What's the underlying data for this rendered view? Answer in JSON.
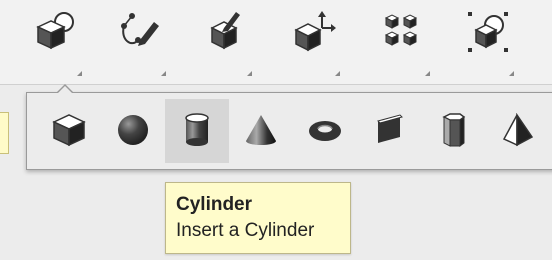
{
  "toolbar": {
    "tools": [
      {
        "name": "insert-shapes-tool",
        "icon": "cube-sphere-icon"
      },
      {
        "name": "paint-tool",
        "icon": "curve-pen-icon"
      },
      {
        "name": "edit-tool",
        "icon": "cube-pen-icon"
      },
      {
        "name": "transform-tool",
        "icon": "cube-axes-icon"
      },
      {
        "name": "group-tool",
        "icon": "cube-grid-icon"
      },
      {
        "name": "selection-tool",
        "icon": "cube-select-icon"
      }
    ]
  },
  "shapes_popup": {
    "selected_index": 2,
    "items": [
      {
        "name": "box",
        "icon": "cube-icon"
      },
      {
        "name": "sphere",
        "icon": "sphere-icon"
      },
      {
        "name": "cylinder",
        "icon": "cylinder-icon"
      },
      {
        "name": "cone",
        "icon": "cone-icon"
      },
      {
        "name": "torus",
        "icon": "torus-icon"
      },
      {
        "name": "wedge",
        "icon": "wedge-icon"
      },
      {
        "name": "prism",
        "icon": "prism-icon"
      },
      {
        "name": "pyramid",
        "icon": "pyramid-icon"
      }
    ]
  },
  "tooltip": {
    "title": "Cylinder",
    "description": "Insert a Cylinder"
  },
  "colors": {
    "tooltip_bg": "#fffccb",
    "icon_dark": "#333333",
    "selected_bg": "#d6d6d6"
  }
}
